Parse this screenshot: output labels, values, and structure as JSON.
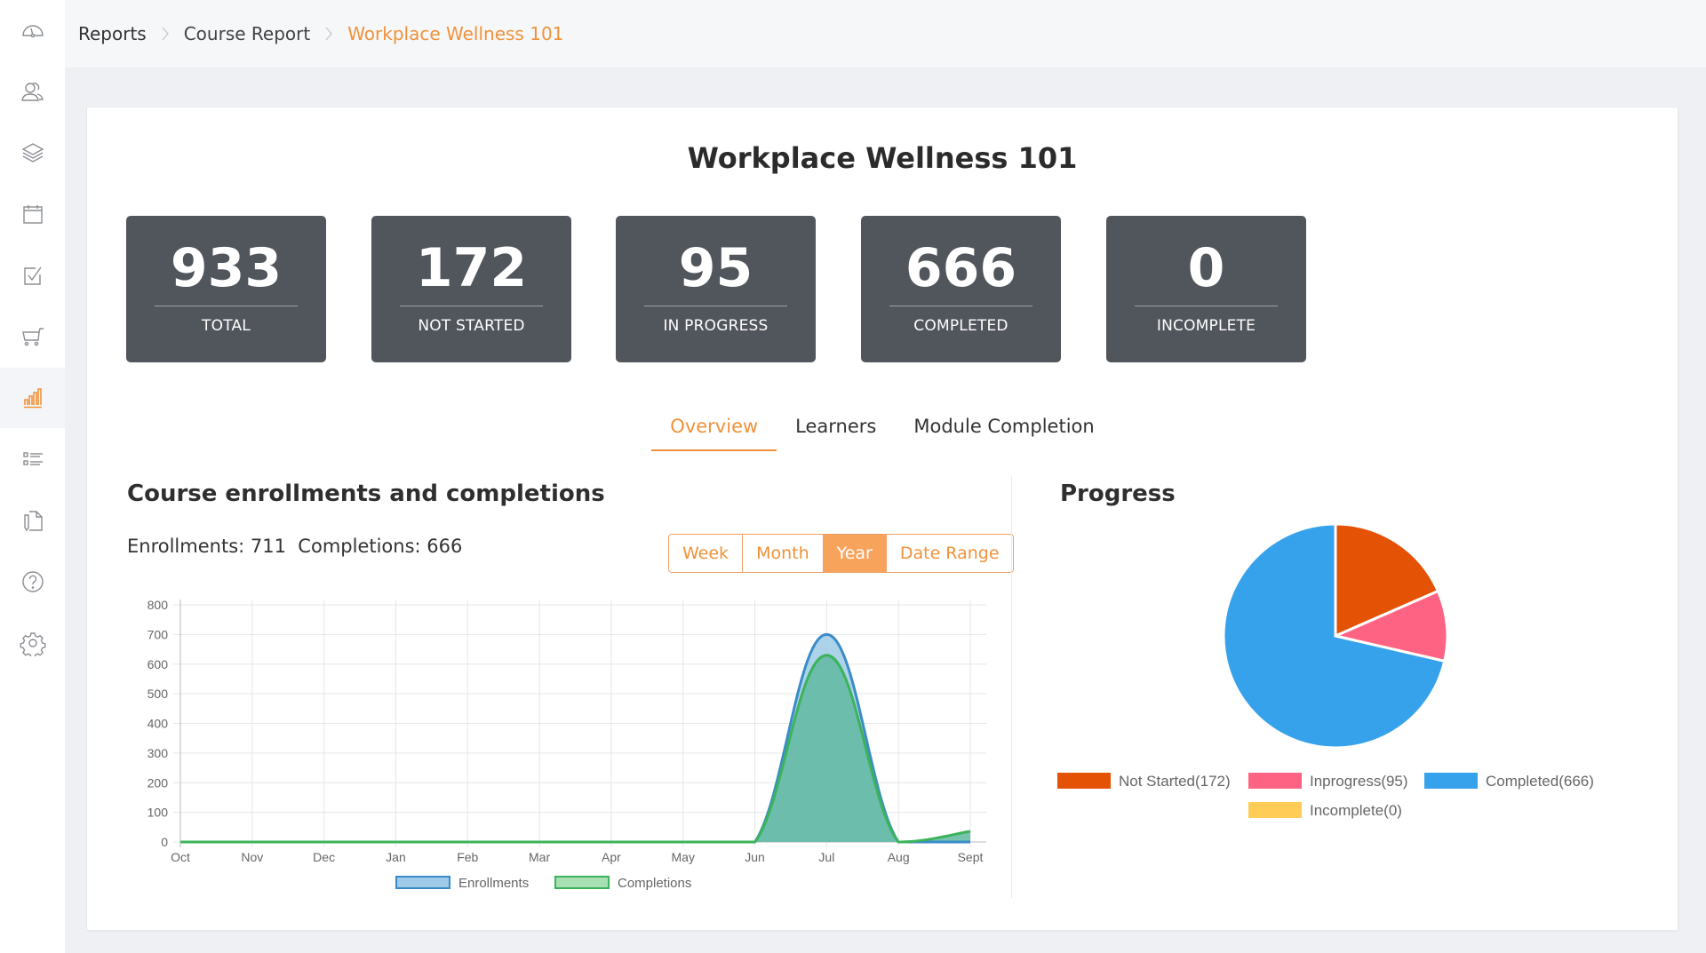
{
  "sidebar": {
    "items": [
      {
        "name": "dashboard",
        "icon": "speedometer-icon",
        "active": false
      },
      {
        "name": "users",
        "icon": "users-icon",
        "active": false
      },
      {
        "name": "courses",
        "icon": "layers-icon",
        "active": false
      },
      {
        "name": "calendar",
        "icon": "calendar-icon",
        "active": false
      },
      {
        "name": "tasks",
        "icon": "checkbox-icon",
        "active": false
      },
      {
        "name": "store",
        "icon": "cart-icon",
        "active": false
      },
      {
        "name": "reports",
        "icon": "bar-chart-icon",
        "active": true
      },
      {
        "name": "lists",
        "icon": "list-icon",
        "active": false
      },
      {
        "name": "documents",
        "icon": "document-edit-icon",
        "active": false
      },
      {
        "name": "help",
        "icon": "help-icon",
        "active": false
      },
      {
        "name": "settings",
        "icon": "gear-icon",
        "active": false
      }
    ]
  },
  "breadcrumb": {
    "items": [
      "Reports",
      "Course Report",
      "Workplace Wellness 101"
    ]
  },
  "course": {
    "title": "Workplace Wellness 101"
  },
  "stats": [
    {
      "value": "933",
      "label": "TOTAL"
    },
    {
      "value": "172",
      "label": "NOT STARTED"
    },
    {
      "value": "95",
      "label": "IN PROGRESS"
    },
    {
      "value": "666",
      "label": "COMPLETED"
    },
    {
      "value": "0",
      "label": "INCOMPLETE"
    }
  ],
  "tabs": [
    {
      "label": "Overview",
      "active": true
    },
    {
      "label": "Learners",
      "active": false
    },
    {
      "label": "Module Completion",
      "active": false
    }
  ],
  "enrollments_section": {
    "title": "Course enrollments and completions",
    "summary": "Enrollments: 711  Completions: 666",
    "range_buttons": [
      {
        "label": "Week",
        "active": false
      },
      {
        "label": "Month",
        "active": false
      },
      {
        "label": "Year",
        "active": true
      },
      {
        "label": "Date Range",
        "active": false
      }
    ]
  },
  "progress_section": {
    "title": "Progress"
  },
  "colors": {
    "accent": "#f0923a",
    "enrollments_line": "#3a8cc8",
    "enrollments_fill": "#9fcbe8",
    "completions_line": "#3cb35a",
    "completions_fill": "#62b8a8",
    "not_started": "#e35205",
    "inprogress": "#ff6384",
    "completed": "#36a2eb",
    "incomplete": "#ffcd56"
  },
  "chart_data": [
    {
      "type": "area",
      "title": "Course enrollments and completions",
      "xlabel": "",
      "ylabel": "",
      "categories": [
        "Oct",
        "Nov",
        "Dec",
        "Jan",
        "Feb",
        "Mar",
        "Apr",
        "May",
        "Jun",
        "Jul",
        "Aug",
        "Sept"
      ],
      "series": [
        {
          "name": "Enrollments",
          "values": [
            0,
            0,
            0,
            0,
            0,
            0,
            0,
            0,
            0,
            700,
            0,
            0
          ]
        },
        {
          "name": "Completions",
          "values": [
            0,
            0,
            0,
            0,
            0,
            0,
            0,
            0,
            0,
            630,
            0,
            36
          ]
        }
      ],
      "ylim": [
        0,
        800
      ],
      "yticks": [
        0,
        100,
        200,
        300,
        400,
        500,
        600,
        700,
        800
      ],
      "grid": true,
      "legend": "bottom"
    },
    {
      "type": "pie",
      "title": "Progress",
      "slices": [
        {
          "label": "Not Started",
          "value": 172,
          "legend": "Not Started(172)"
        },
        {
          "label": "Inprogress",
          "value": 95,
          "legend": "Inprogress(95)"
        },
        {
          "label": "Completed",
          "value": 666,
          "legend": "Completed(666)"
        },
        {
          "label": "Incomplete",
          "value": 0,
          "legend": "Incomplete(0)"
        }
      ],
      "legend": "bottom"
    }
  ]
}
